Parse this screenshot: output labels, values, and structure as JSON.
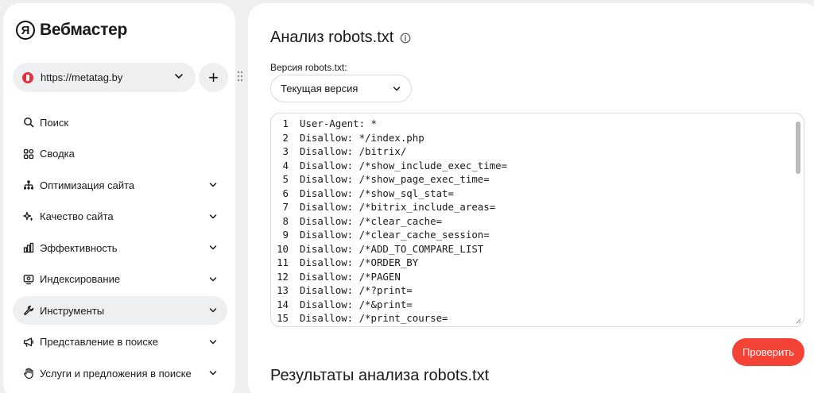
{
  "app": {
    "logo_letter": "Я",
    "logo_name": "Вебмастер"
  },
  "site_selector": {
    "url": "https://metatag.by",
    "add_label": "+"
  },
  "sidebar": {
    "items": [
      {
        "label": "Поиск",
        "icon": "search-icon",
        "has_chevron": false,
        "active": false
      },
      {
        "label": "Сводка",
        "icon": "grid-icon",
        "has_chevron": false,
        "active": false
      },
      {
        "label": "Оптимизация сайта",
        "icon": "hierarchy-icon",
        "has_chevron": true,
        "active": false
      },
      {
        "label": "Качество сайта",
        "icon": "sparkle-icon",
        "has_chevron": true,
        "active": false
      },
      {
        "label": "Эффективность",
        "icon": "bar-chart-icon",
        "has_chevron": true,
        "active": false
      },
      {
        "label": "Индексирование",
        "icon": "monitor-icon",
        "has_chevron": true,
        "active": false
      },
      {
        "label": "Инструменты",
        "icon": "wrench-icon",
        "has_chevron": true,
        "active": true
      },
      {
        "label": "Представление в поиске",
        "icon": "megaphone-icon",
        "has_chevron": true,
        "active": false
      },
      {
        "label": "Услуги и предложения в поиске",
        "icon": "hand-icon",
        "has_chevron": true,
        "active": false
      }
    ]
  },
  "main": {
    "title": "Анализ robots.txt",
    "version_label": "Версия robots.txt:",
    "version_selected": "Текущая версия",
    "check_button": "Проверить",
    "results_title": "Результаты анализа robots.txt"
  },
  "editor": {
    "lines": [
      {
        "num": "1",
        "text": "User-Agent: *"
      },
      {
        "num": "2",
        "text": "Disallow: */index.php"
      },
      {
        "num": "3",
        "text": "Disallow: /bitrix/"
      },
      {
        "num": "4",
        "text": "Disallow: /*show_include_exec_time="
      },
      {
        "num": "5",
        "text": "Disallow: /*show_page_exec_time="
      },
      {
        "num": "6",
        "text": "Disallow: /*show_sql_stat="
      },
      {
        "num": "7",
        "text": "Disallow: /*bitrix_include_areas="
      },
      {
        "num": "8",
        "text": "Disallow: /*clear_cache="
      },
      {
        "num": "9",
        "text": "Disallow: /*clear_cache_session="
      },
      {
        "num": "10",
        "text": "Disallow: /*ADD_TO_COMPARE_LIST"
      },
      {
        "num": "11",
        "text": "Disallow: /*ORDER_BY"
      },
      {
        "num": "12",
        "text": "Disallow: /*PAGEN"
      },
      {
        "num": "13",
        "text": "Disallow: /*?print="
      },
      {
        "num": "14",
        "text": "Disallow: /*&print="
      },
      {
        "num": "15",
        "text": "Disallow: /*print_course="
      }
    ]
  },
  "colors": {
    "accent": "#f44336",
    "background": "#eeeff1",
    "panel": "#ffffff"
  }
}
